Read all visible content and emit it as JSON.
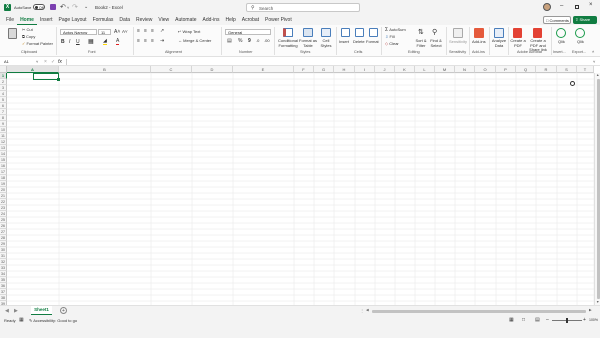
{
  "titlebar": {
    "autosave_label": "AutoSave",
    "autosave_state": "Off",
    "doc_title": "Book2 - Excel",
    "search_placeholder": "Search"
  },
  "menu": [
    "File",
    "Home",
    "Insert",
    "Page Layout",
    "Formulas",
    "Data",
    "Review",
    "View",
    "Automate",
    "Add-ins",
    "Help",
    "Acrobat",
    "Power Pivot"
  ],
  "actions": {
    "comments": "Comments",
    "share": "Share"
  },
  "ribbon": {
    "clipboard": {
      "cut": "Cut",
      "copy": "Copy",
      "format_painter": "Format Painter",
      "label": "Clipboard"
    },
    "font": {
      "name": "Aptos Narrow",
      "size": "11",
      "label": "Font"
    },
    "alignment": {
      "wrap_text": "Wrap Text",
      "merge_center": "Merge & Center",
      "label": "Alignment"
    },
    "number": {
      "format": "General",
      "label": "Number"
    },
    "styles": {
      "conditional": "Conditional Formatting",
      "format_table": "Format as Table",
      "cell_styles": "Cell Styles",
      "label": "Styles"
    },
    "cells": {
      "insert": "Insert",
      "delete": "Delete",
      "format": "Format",
      "label": "Cells"
    },
    "editing": {
      "autosum": "AutoSum",
      "fill": "Fill",
      "clear": "Clear",
      "sort_filter": "Sort & Filter",
      "find_select": "Find & Select",
      "label": "Editing"
    },
    "sensitivity": {
      "button": "Sensitivity",
      "label": "Sensitivity"
    },
    "addins": {
      "button": "Add-ins",
      "label": "Add-ins"
    },
    "analyze": {
      "button": "Analyze Data"
    },
    "acrobat": {
      "create_pdf": "Create a PDF",
      "create_share": "Create a PDF and Share link",
      "label": "Adobe Acrobat"
    },
    "qlik1": {
      "button": "Qlik",
      "label": "Insert..."
    },
    "qlik2": {
      "button": "Qlik",
      "label": "Export..."
    }
  },
  "formula_bar": {
    "name_box": "A1",
    "fx": "fx",
    "value": ""
  },
  "columns": [
    "A",
    "B",
    "C",
    "D",
    "E",
    "F",
    "G",
    "H",
    "I",
    "J",
    "K",
    "L",
    "M",
    "N",
    "O",
    "P",
    "Q",
    "R",
    "S",
    "T"
  ],
  "rows": [
    "1",
    "2",
    "3",
    "4",
    "5",
    "6",
    "7",
    "8",
    "9",
    "10",
    "11",
    "12",
    "13",
    "14",
    "15",
    "16",
    "17",
    "18",
    "19",
    "20",
    "21",
    "22",
    "23",
    "24",
    "25",
    "26",
    "27",
    "28",
    "29",
    "30",
    "31",
    "32",
    "33",
    "34",
    "35",
    "36",
    "37",
    "38",
    "39"
  ],
  "sheet_tabs": [
    "Sheet1"
  ],
  "status": {
    "ready": "Ready",
    "accessibility": "Accessibility: Good to go",
    "zoom": "100%"
  }
}
